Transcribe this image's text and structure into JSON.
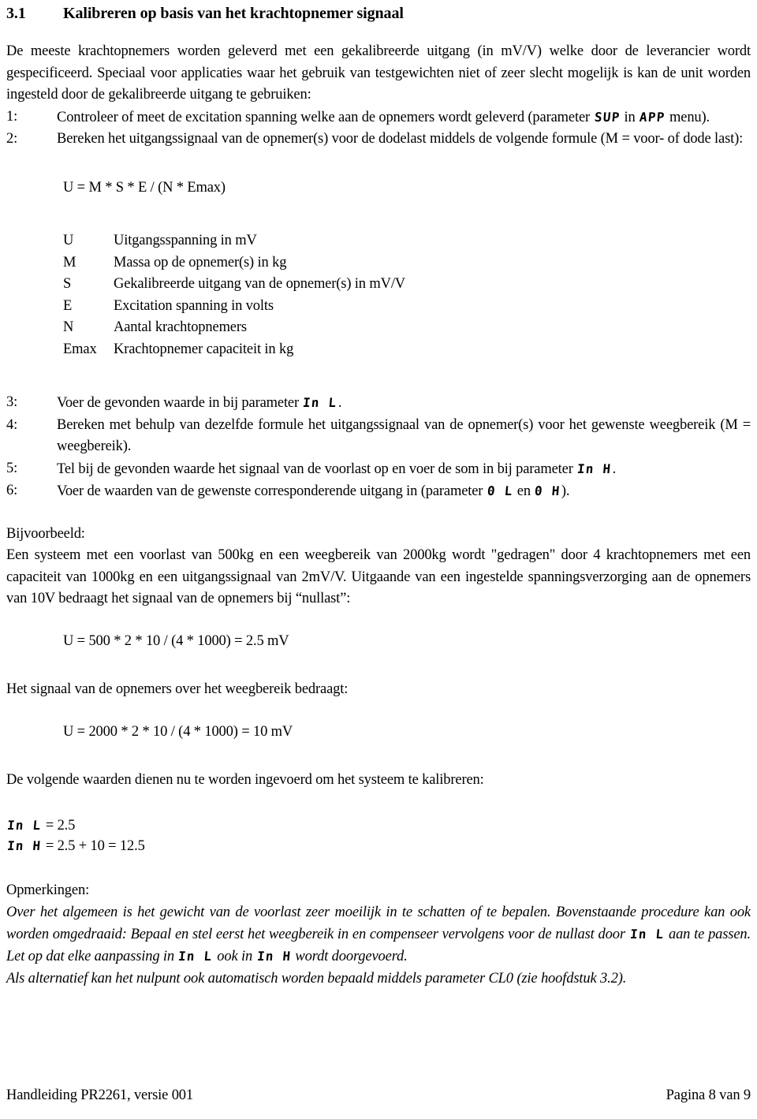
{
  "document": {
    "heading": {
      "number": "3.1",
      "title": "Kalibreren op basis van het krachtopnemer signaal"
    },
    "intro_paragraph": "De meeste krachtopnemers worden geleverd met een gekalibreerde uitgang (in mV/V) welke door de leverancier wordt gespecificeerd. Speciaal voor applicaties waar het gebruik van testgewichten niet of zeer slecht mogelijk is kan de unit worden ingesteld door de gekalibreerde uitgang te gebruiken:",
    "steps": [
      {
        "number": "1:",
        "text_before": "Controleer of meet de excitation spanning welke aan de opnemers wordt geleverd (parameter ",
        "param1": "SUP",
        "text_middle": " in ",
        "param2": "APP",
        "text_after": " menu)."
      },
      {
        "number": "2:",
        "text_before": "Bereken het uitgangssignaal van de opnemer(s) voor de dodelast middels de volgende formule (M = voor- of dode last):",
        "param1": "",
        "text_middle": "",
        "param2": "",
        "text_after": ""
      },
      {
        "number": "3:",
        "text_before": "Voer de gevonden waarde in bij parameter ",
        "param1": "In L",
        "text_middle": "",
        "param2": "",
        "text_after": "."
      },
      {
        "number": "4:",
        "text_before": "Bereken met behulp van dezelfde formule het uitgangssignaal van de opnemer(s) voor het gewenste weegbereik (M = weegbereik).",
        "param1": "",
        "text_middle": "",
        "param2": "",
        "text_after": ""
      },
      {
        "number": "5:",
        "text_before": "Tel bij de gevonden waarde het signaal van de voorlast op en voer de som in bij parameter ",
        "param1": "In H",
        "text_middle": "",
        "param2": "",
        "text_after": "."
      },
      {
        "number": "6:",
        "text_before": "Voer de waarden van de gewenste corresponderende uitgang in (parameter ",
        "param1": "0 L",
        "text_middle": " en ",
        "param2": "0 H",
        "text_after": ")."
      }
    ],
    "main_formula": "U = M * S * E / (N * Emax)",
    "legend": [
      {
        "symbol": "U",
        "description": "Uitgangsspanning in mV"
      },
      {
        "symbol": "M",
        "description": "Massa op de opnemer(s) in kg"
      },
      {
        "symbol": "S",
        "description": "Gekalibreerde uitgang van de opnemer(s) in mV/V"
      },
      {
        "symbol": "E",
        "description": "Excitation spanning in volts"
      },
      {
        "symbol": "N",
        "description": "Aantal krachtopnemers"
      },
      {
        "symbol": "Emax",
        "description": "Krachtopnemer capaciteit in kg"
      }
    ],
    "example": {
      "label": "Bijvoorbeeld:",
      "paragraph": "Een systeem met een voorlast van 500kg en een weegbereik van 2000kg wordt \"gedragen\" door 4 krachtopnemers met een capaciteit van 1000kg en een uitgangssignaal van 2mV/V. Uitgaande van een ingestelde spanningsverzorging aan de opnemers van 10V bedraagt het signaal van de opnemers bij “nullast”:",
      "formula_zero": "U = 500 * 2 * 10 / (4 * 1000) = 2.5 mV",
      "range_intro": "Het signaal van de opnemers over het weegbereik bedraagt:",
      "formula_range": "U = 2000 * 2 * 10 / (4 * 1000) = 10 mV",
      "values_intro": "De volgende waarden dienen nu te worden ingevoerd om het systeem te kalibreren:",
      "values": [
        {
          "param": "In L",
          "equation": " = 2.5"
        },
        {
          "param": "In H",
          "equation": " = 2.5 + 10 = 12.5"
        }
      ]
    },
    "notes": {
      "title": "Opmerkingen:",
      "line1_a": "Over het algemeen is het gewicht van de voorlast zeer moeilijk in te schatten of te bepalen. Bovenstaande procedure kan ook worden omgedraaid: Bepaal en stel eerst het weegbereik in en compenseer vervolgens voor de nullast door ",
      "line1_param1": "In L",
      "line1_b": " aan te passen. Let op dat elke aanpassing in ",
      "line1_param2": "In L",
      "line1_c": " ook in ",
      "line1_param3": "In H",
      "line1_d": " wordt doorgevoerd.",
      "line2": "Als alternatief kan het nulpunt ook automatisch worden bepaald middels parameter CL0 (zie hoofdstuk 3.2)."
    },
    "footer": {
      "left": "Handleiding PR2261, versie 001",
      "right": "Pagina 8 van 9"
    }
  },
  "colors": {
    "text": "#000000",
    "background": "#ffffff"
  }
}
